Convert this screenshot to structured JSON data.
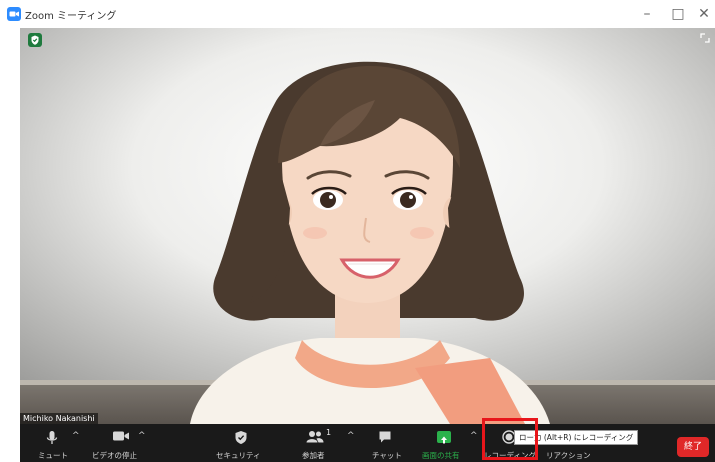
{
  "window": {
    "title": "Zoom ミーティング",
    "controls": {
      "minimize": "–",
      "maximize": "□",
      "close": "✕"
    }
  },
  "video": {
    "participant_name": "Michiko Nakanishi",
    "security_badge_icon": "shield-check-icon",
    "expand_icon": "expand-icon"
  },
  "toolbar": {
    "mute_label": "ミュート",
    "video_label": "ビデオの停止",
    "security_label": "セキュリティ",
    "participants_label": "参加者",
    "participants_count": "1",
    "chat_label": "チャット",
    "share_label": "画面の共有",
    "record_label": "レコーディング",
    "reactions_label": "リアクション",
    "end_label": "終了"
  },
  "tooltip": {
    "text": "ロー力  (Alt+R) にレコーディング"
  },
  "colors": {
    "toolbar_bg": "#1a1a1a",
    "share_green": "#2bb24c",
    "end_red": "#e02828",
    "highlight_red": "#e8161b",
    "zoom_blue": "#2d8cff"
  }
}
